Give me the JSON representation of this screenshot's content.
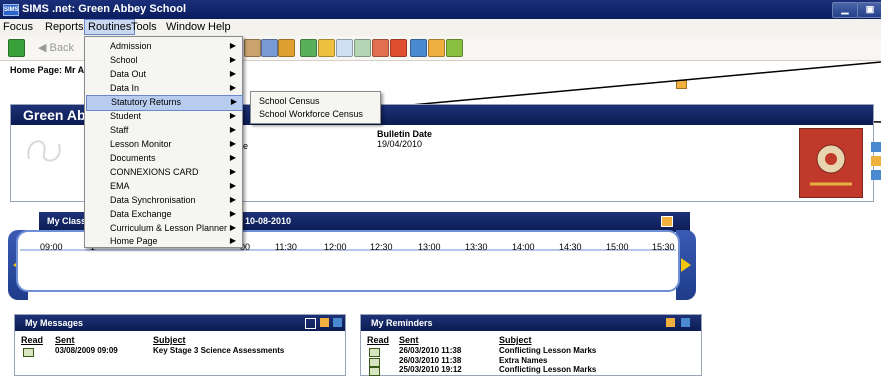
{
  "window": {
    "app_icon": "SIMS",
    "title": "SIMS .net: Green Abbey School"
  },
  "menubar": {
    "items": [
      "Focus",
      "Reports",
      "Routines",
      "Tools",
      "Window",
      "Help"
    ]
  },
  "toolbar": {
    "back_label": "Back"
  },
  "home": {
    "label": "Home Page: Mr A B"
  },
  "banner": {
    "school_partial": "Green Abb",
    "module_partial": "dule",
    "bulletin_label": "Bulletin Date",
    "bulletin_value": "19/04/2010"
  },
  "class_panel": {
    "title_partial": "My Class",
    "date_partial": "r 10-08-2010"
  },
  "timeline": {
    "times": [
      "09:00",
      "1",
      "00",
      "11:30",
      "12:00",
      "12:30",
      "13:00",
      "13:30",
      "14:00",
      "14:30",
      "15:00",
      "15:30"
    ]
  },
  "routines_menu": {
    "items": [
      {
        "label": "Admission"
      },
      {
        "label": "School"
      },
      {
        "label": "Data Out"
      },
      {
        "label": "Data In"
      },
      {
        "label": "Statutory Returns"
      },
      {
        "label": "Student"
      },
      {
        "label": "Staff"
      },
      {
        "label": "Lesson Monitor"
      },
      {
        "label": "Documents"
      },
      {
        "label": "CONNEXIONS CARD"
      },
      {
        "label": "EMA"
      },
      {
        "label": "Data Synchronisation"
      },
      {
        "label": "Data Exchange"
      },
      {
        "label": "Curriculum & Lesson Planner"
      },
      {
        "label": "Home Page"
      }
    ],
    "submenu": [
      "School Census",
      "School Workforce Census"
    ]
  },
  "messages": {
    "title": "My Messages",
    "headers": [
      "Read",
      "Sent",
      "Subject"
    ],
    "rows": [
      {
        "sent": "03/08/2009 09:09",
        "subject": "Key Stage 3 Science Assessments"
      }
    ]
  },
  "reminders": {
    "title": "My Reminders",
    "headers": [
      "Read",
      "Sent",
      "Subject"
    ],
    "rows": [
      {
        "sent": "26/03/2010 11:38",
        "subject": "Conflicting Lesson Marks"
      },
      {
        "sent": "26/03/2010 11:38",
        "subject": "Extra Names"
      },
      {
        "sent": "25/03/2010 19:12",
        "subject": "Conflicting Lesson Marks"
      }
    ]
  },
  "colors": {
    "header_blue": "#0b1b52",
    "menu_highlight": "#b8ccf0",
    "accent_arrow": "#f1c40f"
  }
}
